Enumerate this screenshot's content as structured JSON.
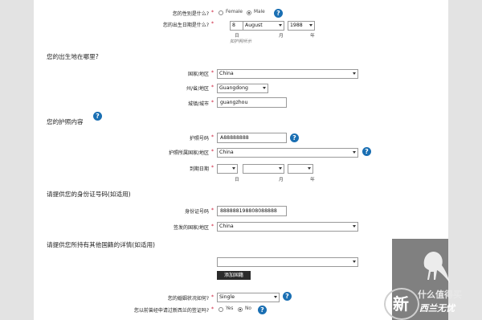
{
  "gender": {
    "label": "您的性别是什么?",
    "options": [
      "Female",
      "Male"
    ],
    "selected": "Male"
  },
  "dob": {
    "label": "您的出生日期是什么?",
    "day": "8",
    "month": "August",
    "year": "1988",
    "units": [
      "日",
      "月",
      "年"
    ],
    "hint": "如护照所示"
  },
  "birthplace": {
    "heading": "您的出生地在哪里?",
    "country_label": "国家/地区",
    "country": "China",
    "state_label": "州/省/地区",
    "state": "Guangdong",
    "city_label": "城镇/城市",
    "city": "guangzhou"
  },
  "passport": {
    "heading": "您的护照内容",
    "number_label": "护照号码",
    "number": "A88888888",
    "country_label": "护照所属国家/地区",
    "country": "China",
    "expiry_label": "到期日期",
    "units": [
      "日",
      "月",
      "年"
    ]
  },
  "id_card": {
    "heading": "请提供您的身份证号码(如适用)",
    "number_label": "身份证号码",
    "number": "888888198808088888",
    "country_label": "签发的国家/地区",
    "country": "China"
  },
  "nationality": {
    "heading": "请提供您所持有其他国籍的详情(如适用)",
    "add_button": "添加国籍"
  },
  "marital": {
    "label": "您的婚姻状况如何?",
    "value": "Single"
  },
  "nz_visa": {
    "label": "您以前曾经申请过新西兰的签证吗?",
    "options": [
      "Yes",
      "No"
    ],
    "selected": "No"
  },
  "watermark": {
    "text1": "什么值得买",
    "text2": "西兰无忧",
    "glyph": "新"
  },
  "colors": {
    "required": "#c8102e",
    "help": "#1a6fb3",
    "button": "#2b2b2b"
  }
}
